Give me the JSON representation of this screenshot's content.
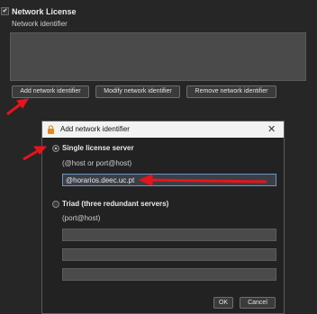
{
  "panel": {
    "checkbox_mark": "✔",
    "title": "Network License",
    "subtitle": "Network identifier",
    "buttons": {
      "add": "Add network identifier",
      "modify": "Modify network identifier",
      "remove": "Remove network identifier"
    }
  },
  "dialog": {
    "title": "Add network identifier",
    "close": "✕",
    "single": {
      "label": "Single license server",
      "hint": "(@host or port@host)",
      "value": "@horarios.deec.uc.pt"
    },
    "triad": {
      "label": "Triad (three redundant servers)",
      "hint": "(port@host)"
    },
    "ok": "OK",
    "cancel": "Cancel"
  },
  "colors": {
    "annotation_arrow": "#e8141b",
    "background": "#262626",
    "lock": "#e08a1e"
  }
}
